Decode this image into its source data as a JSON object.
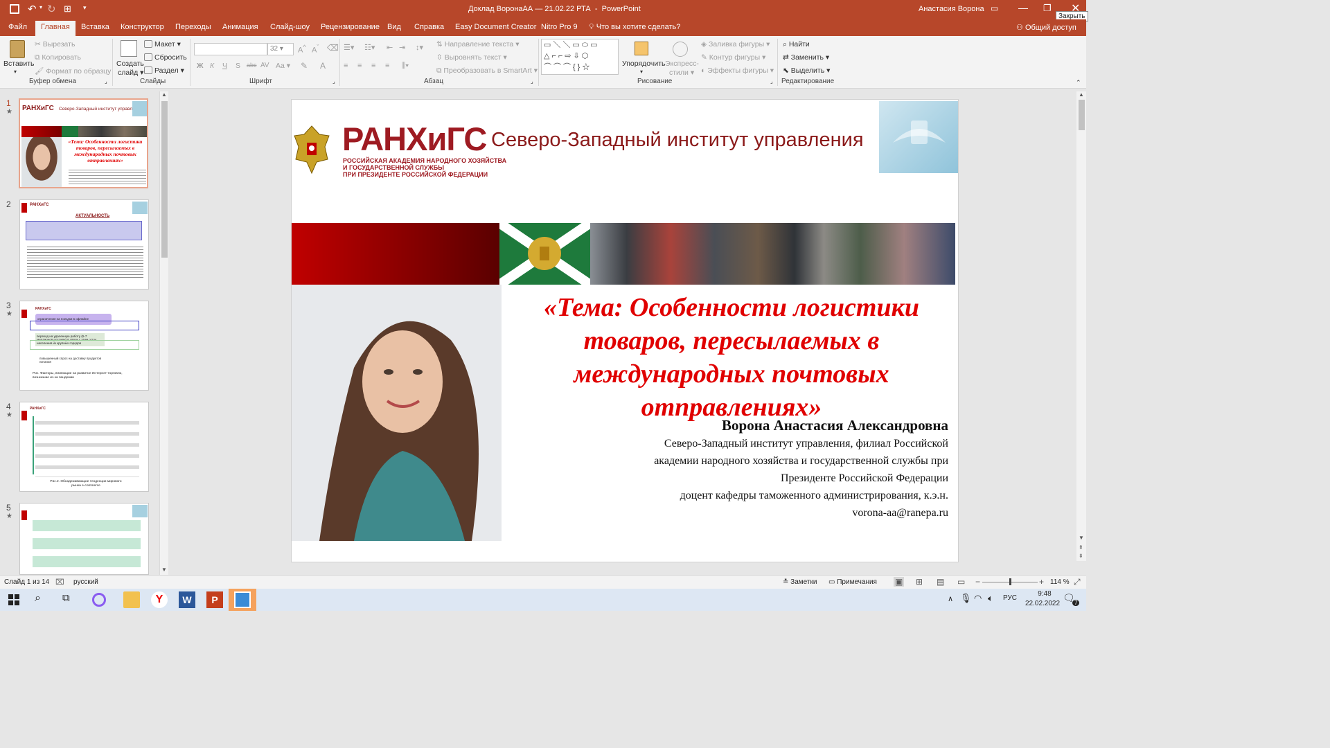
{
  "titlebar": {
    "doc_title": "Доклад ВоронаАА — 21.02.22 РТА",
    "app": "PowerPoint",
    "user": "Анастасия Ворона",
    "close_tooltip": "Закрыть"
  },
  "tabs": [
    "Файл",
    "Главная",
    "Вставка",
    "Конструктор",
    "Переходы",
    "Анимация",
    "Слайд-шоу",
    "Рецензирование",
    "Вид",
    "Справка",
    "Easy Document Creator",
    "Nitro Pro 9"
  ],
  "tell_me": "Что вы хотите сделать?",
  "share": "Общий доступ",
  "ribbon": {
    "clipboard": {
      "paste": "Вставить",
      "cut": "Вырезать",
      "copy": "Копировать",
      "format_painter": "Формат по образцу",
      "group": "Буфер обмена"
    },
    "slides": {
      "new_slide": "Создать слайд",
      "layout": "Макет",
      "reset": "Сбросить",
      "section": "Раздел",
      "group": "Слайды"
    },
    "font": {
      "font_name": "",
      "font_size": "32",
      "bold": "Ж",
      "italic": "К",
      "underline": "Ч",
      "shadow": "S",
      "strike": "abc",
      "case": "Aa",
      "group": "Шрифт"
    },
    "paragraph": {
      "text_dir": "Направление текста",
      "align_text": "Выровнять текст",
      "smartart": "Преобразовать в SmartArt",
      "group": "Абзац"
    },
    "drawing": {
      "arrange": "Упорядочить",
      "quick_styles": "Экспресс-стили",
      "fill": "Заливка фигуры",
      "outline": "Контур фигуры",
      "effects": "Эффекты фигуры",
      "group": "Рисование"
    },
    "editing": {
      "find": "Найти",
      "replace": "Заменить",
      "select": "Выделить",
      "group": "Редактирование"
    }
  },
  "thumbnails": [
    {
      "num": "1",
      "selected": true,
      "header": "Северо-Западный институт управления",
      "title": "«Тема: Особенности логистики товаров, пересылаемых в международных почтовых отправлениях»"
    },
    {
      "num": "2",
      "selected": false,
      "header": "АКТУАЛЬНОСТЬ"
    },
    {
      "num": "3",
      "selected": false,
      "items": [
        "ограничения на поездки в офлайне",
        "переход на удаленную работу (5-7 миллионов россиян) в связи с этим отток населения из крупных городов",
        "повышенный спрос на доставку продуктов питания"
      ],
      "caption": "Рис. Факторы, влияющие на развитие Интернет-торговли, возникшие из-за пандемии"
    },
    {
      "num": "4",
      "selected": false,
      "caption": "Рис.2. Обнадеживающие тенденции мирового рынка e-commerce"
    },
    {
      "num": "5",
      "selected": false
    }
  ],
  "slide": {
    "logo_abbr": "РАНХиГС",
    "logo_lines": [
      "РОССИЙСКАЯ АКАДЕМИЯ НАРОДНОГО ХОЗЯЙСТВА",
      "И ГОСУДАРСТВЕННОЙ СЛУЖБЫ",
      "ПРИ ПРЕЗИДЕНТЕ РОССИЙСКОЙ ФЕДЕРАЦИИ"
    ],
    "institute": "Северо-Западный институт управления",
    "title_lines": [
      "«Тема: Особенности логистики",
      "товаров, пересылаемых в",
      "международных почтовых",
      "отправлениях»"
    ],
    "author": "Ворона Анастасия Александровна",
    "affiliation_lines": [
      "Северо-Западный институт управления, филиал Российской",
      "академии народного хозяйства и государственной службы при",
      "Президенте Российской Федерации",
      "доцент кафедры таможенного администрирования, к.э.н.",
      "vorona-aa@ranepa.ru"
    ]
  },
  "status": {
    "slide_of": "Слайд 1 из 14",
    "language": "русский",
    "notes": "Заметки",
    "comments": "Примечания",
    "zoom": "114 %"
  },
  "taskbar": {
    "lang": "РУС",
    "time": "9:48",
    "date": "22.02.2022",
    "notif_count": "7"
  },
  "colors": {
    "accent": "#b7472a",
    "slide_title": "#e00000",
    "institute": "#8b1a1a",
    "green": "#1e7a3c"
  }
}
